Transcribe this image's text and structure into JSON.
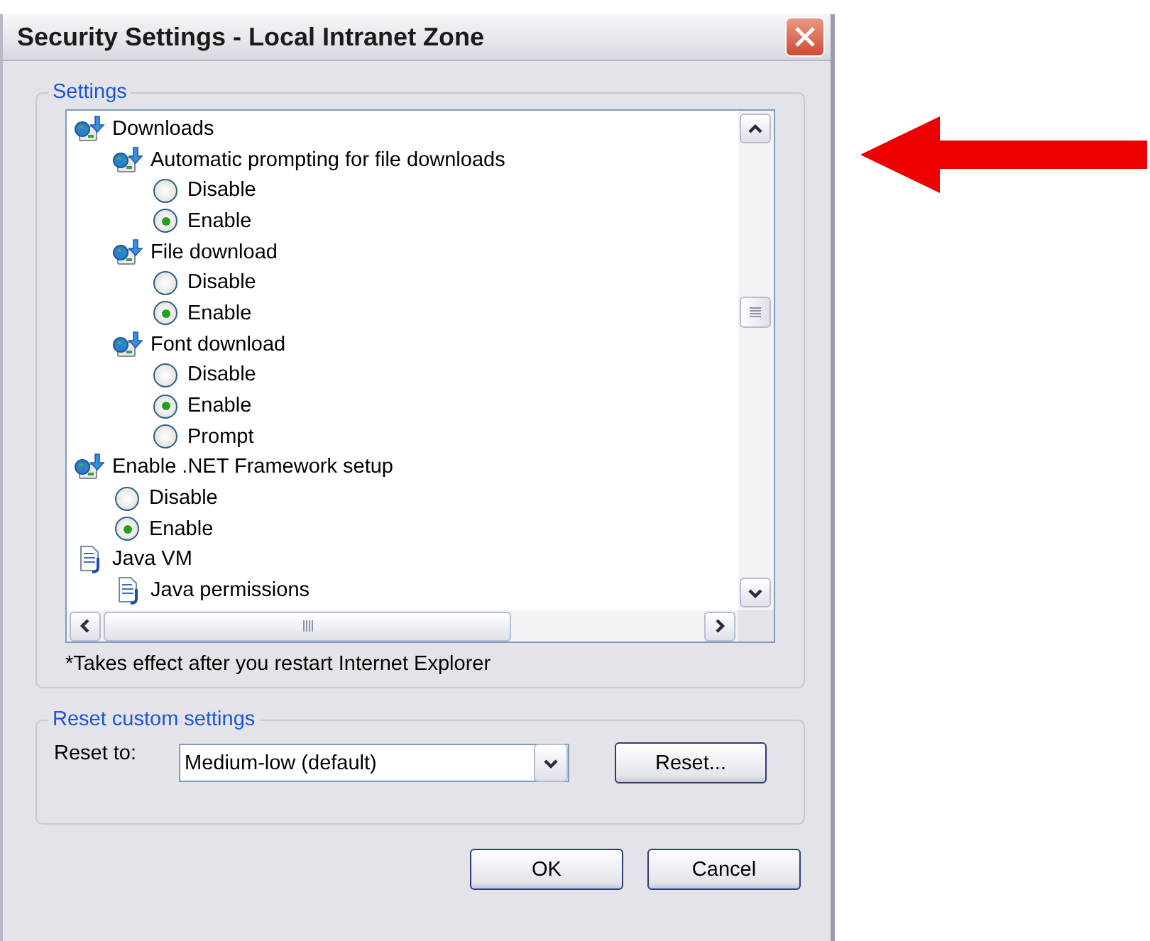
{
  "window": {
    "title": "Security Settings - Local Intranet Zone"
  },
  "settings": {
    "label": "Settings",
    "tree": [
      {
        "kind": "download",
        "label": "Downloads",
        "children": [
          {
            "kind": "download",
            "label": "Automatic prompting for file downloads",
            "children": [
              {
                "kind": "option",
                "label": "Disable",
                "selected": false
              },
              {
                "kind": "option",
                "label": "Enable",
                "selected": true
              }
            ]
          },
          {
            "kind": "download",
            "label": "File download",
            "children": [
              {
                "kind": "option",
                "label": "Disable",
                "selected": false
              },
              {
                "kind": "option",
                "label": "Enable",
                "selected": true
              }
            ]
          },
          {
            "kind": "download",
            "label": "Font download",
            "children": [
              {
                "kind": "option",
                "label": "Disable",
                "selected": false
              },
              {
                "kind": "option",
                "label": "Enable",
                "selected": true
              },
              {
                "kind": "option",
                "label": "Prompt",
                "selected": false
              }
            ]
          }
        ]
      },
      {
        "kind": "download",
        "label": "Enable .NET Framework setup",
        "children": [
          {
            "kind": "option",
            "label": "Disable",
            "selected": false
          },
          {
            "kind": "option",
            "label": "Enable",
            "selected": true
          }
        ]
      },
      {
        "kind": "document",
        "label": "Java VM",
        "children": [
          {
            "kind": "document",
            "label": "Java permissions"
          }
        ]
      }
    ],
    "note": "*Takes effect after you restart Internet Explorer"
  },
  "reset": {
    "label": "Reset custom settings",
    "field_label": "Reset to:",
    "value": "Medium-low (default)",
    "button": "Reset..."
  },
  "buttons": [
    "OK",
    "Cancel"
  ]
}
